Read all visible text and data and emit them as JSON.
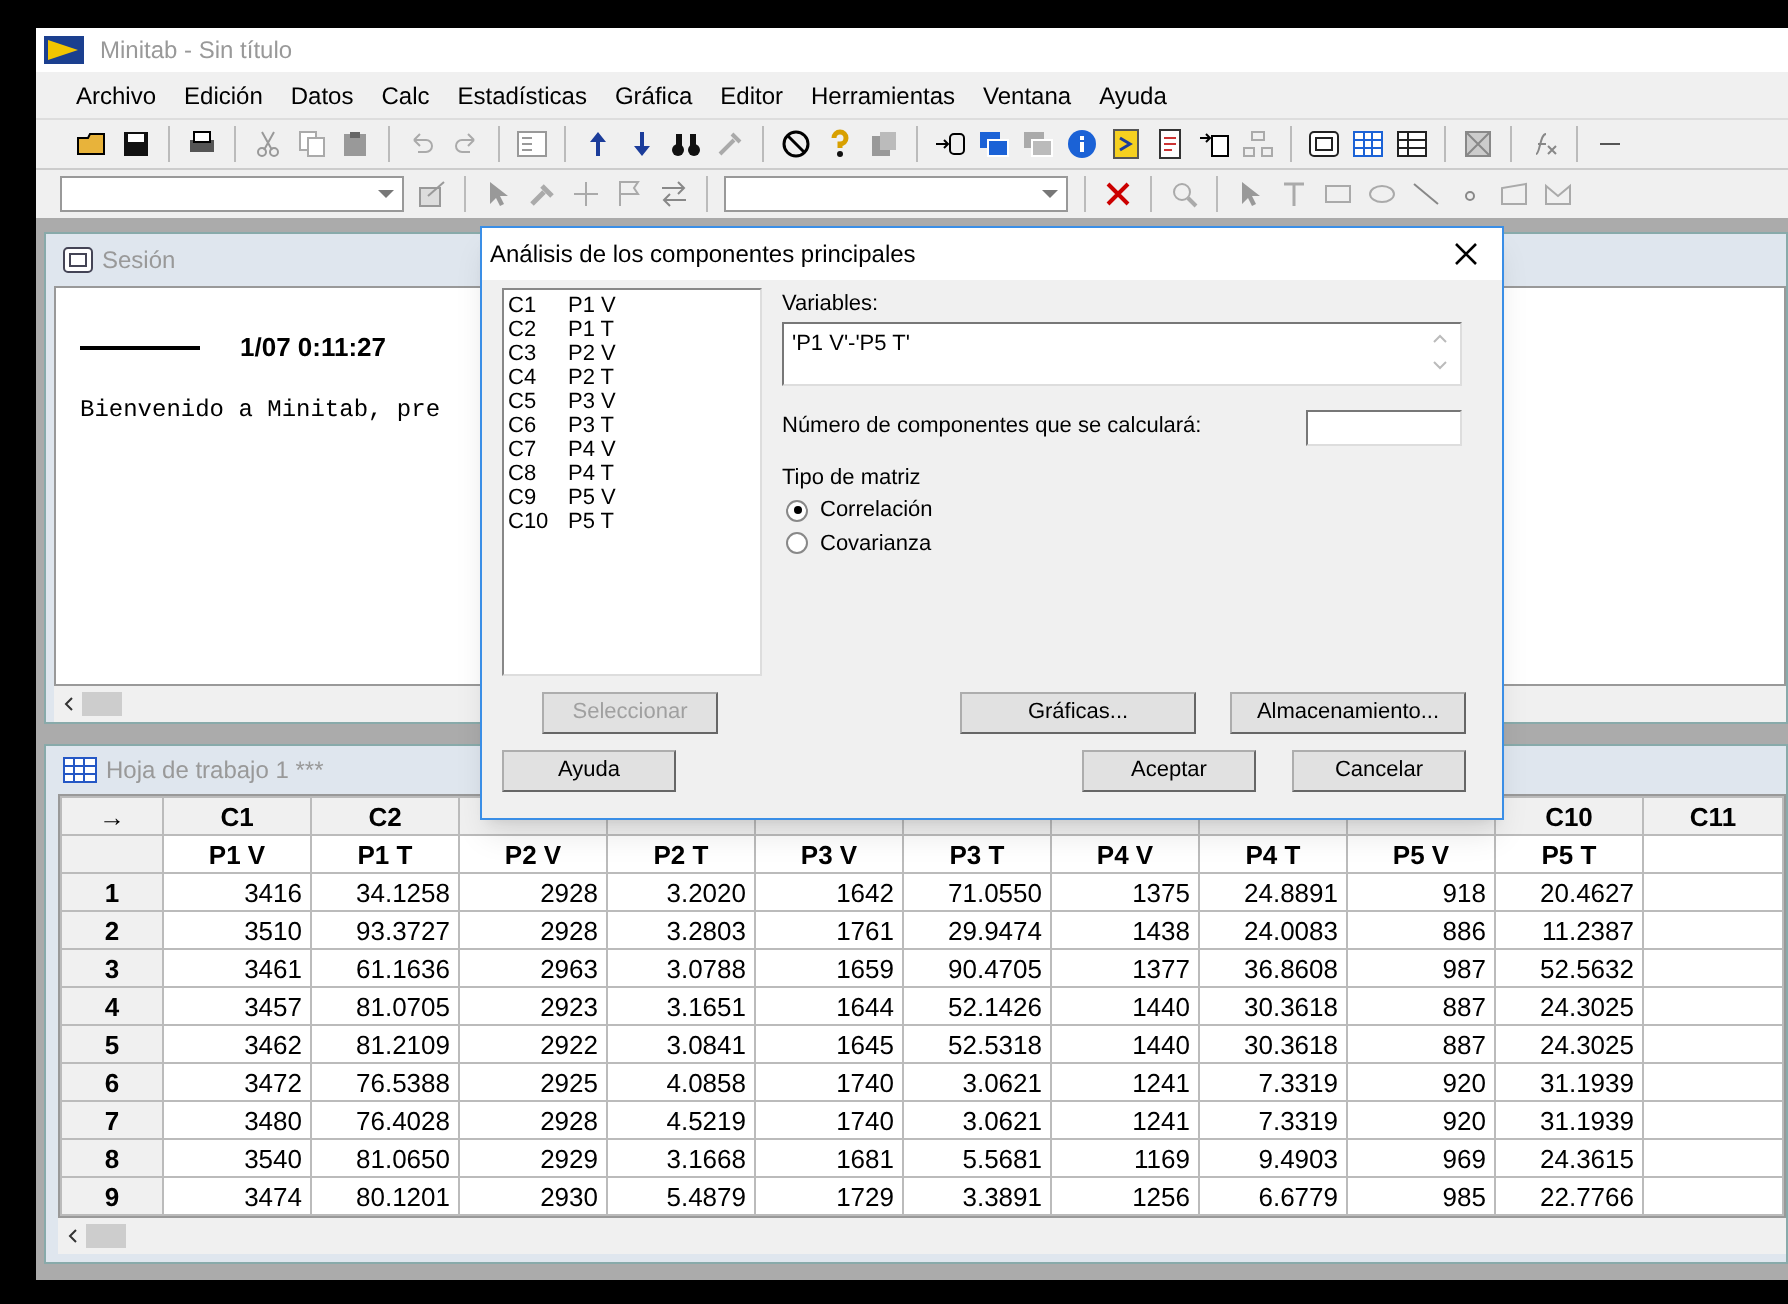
{
  "window": {
    "title": "Minitab - Sin título"
  },
  "menu": [
    {
      "label": "Archivo"
    },
    {
      "label": "Edición"
    },
    {
      "label": "Datos"
    },
    {
      "label": "Calc"
    },
    {
      "label": "Estadísticas"
    },
    {
      "label": "Gráfica"
    },
    {
      "label": "Editor"
    },
    {
      "label": "Herramientas"
    },
    {
      "label": "Ventana"
    },
    {
      "label": "Ayuda"
    }
  ],
  "session": {
    "title": "Sesión",
    "timestamp": "1/07 0:11:27",
    "message": "Bienvenido a Minitab, pre"
  },
  "dialog": {
    "title": "Análisis de los componentes principales",
    "columns_list": [
      {
        "column": "C1",
        "name": "P1 V"
      },
      {
        "column": "C2",
        "name": "P1 T"
      },
      {
        "column": "C3",
        "name": "P2 V"
      },
      {
        "column": "C4",
        "name": "P2 T"
      },
      {
        "column": "C5",
        "name": "P3 V"
      },
      {
        "column": "C6",
        "name": "P3 T"
      },
      {
        "column": "C7",
        "name": "P4 V"
      },
      {
        "column": "C8",
        "name": "P4 T"
      },
      {
        "column": "C9",
        "name": "P5 V"
      },
      {
        "column": "C10",
        "name": "P5 T"
      }
    ],
    "variables_label": "Variables:",
    "variables_value": "'P1 V'-'P5 T'",
    "components_label": "Número de componentes que se calculará:",
    "matrix_label": "Tipo de matriz",
    "matrix_options": [
      {
        "label": "Correlación",
        "selected": true
      },
      {
        "label": "Covarianza",
        "selected": false
      }
    ],
    "buttons": [
      {
        "label": "Seleccionar",
        "disabled": true
      },
      {
        "label": "Gráficas...",
        "disabled": false
      },
      {
        "label": "Almacenamiento...",
        "disabled": false
      },
      {
        "label": "Ayuda",
        "disabled": false
      },
      {
        "label": "Aceptar",
        "disabled": false
      },
      {
        "label": "Cancelar",
        "disabled": false
      }
    ]
  },
  "worksheet": {
    "title": "Hoja de trabajo 1 ***",
    "corner": "→",
    "columns": [
      {
        "id": "C1",
        "name": "P1 V"
      },
      {
        "id": "C2",
        "name": "P1 T"
      },
      {
        "name": "P2 V"
      },
      {
        "name": "P2 T"
      },
      {
        "name": "P3 V"
      },
      {
        "name": "P3 T"
      },
      {
        "name": "P4 V"
      },
      {
        "name": "P4 T"
      },
      {
        "name": "P5 V"
      },
      {
        "id": "C10",
        "name": "P5 T"
      },
      {
        "id": "C11"
      }
    ],
    "rows": [
      {
        "index": "1",
        "cells": [
          "3416",
          "34.1258",
          "2928",
          "3.2020",
          "1642",
          "71.0550",
          "1375",
          "24.8891",
          "918",
          "20.4627"
        ]
      },
      {
        "index": "2",
        "cells": [
          "3510",
          "93.3727",
          "2928",
          "3.2803",
          "1761",
          "29.9474",
          "1438",
          "24.0083",
          "886",
          "11.2387"
        ]
      },
      {
        "index": "3",
        "cells": [
          "3461",
          "61.1636",
          "2963",
          "3.0788",
          "1659",
          "90.4705",
          "1377",
          "36.8608",
          "987",
          "52.5632"
        ]
      },
      {
        "index": "4",
        "cells": [
          "3457",
          "81.0705",
          "2923",
          "3.1651",
          "1644",
          "52.1426",
          "1440",
          "30.3618",
          "887",
          "24.3025"
        ]
      },
      {
        "index": "5",
        "cells": [
          "3462",
          "81.2109",
          "2922",
          "3.0841",
          "1645",
          "52.5318",
          "1440",
          "30.3618",
          "887",
          "24.3025"
        ]
      },
      {
        "index": "6",
        "cells": [
          "3472",
          "76.5388",
          "2925",
          "4.0858",
          "1740",
          "3.0621",
          "1241",
          "7.3319",
          "920",
          "31.1939"
        ]
      },
      {
        "index": "7",
        "cells": [
          "3480",
          "76.4028",
          "2928",
          "4.5219",
          "1740",
          "3.0621",
          "1241",
          "7.3319",
          "920",
          "31.1939"
        ]
      },
      {
        "index": "8",
        "cells": [
          "3540",
          "81.0650",
          "2929",
          "3.1668",
          "1681",
          "5.5681",
          "1169",
          "9.4903",
          "969",
          "24.3615"
        ]
      },
      {
        "index": "9",
        "cells": [
          "3474",
          "80.1201",
          "2930",
          "5.4879",
          "1729",
          "3.3891",
          "1256",
          "6.6779",
          "985",
          "22.7766"
        ]
      }
    ]
  }
}
